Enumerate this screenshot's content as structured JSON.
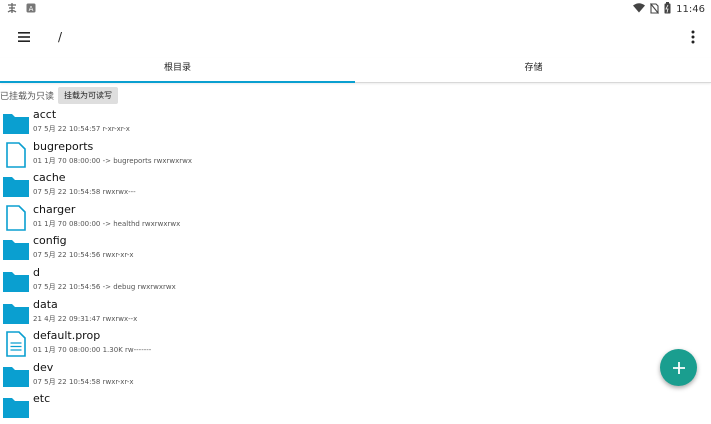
{
  "status_bar": {
    "time": "11:46"
  },
  "toolbar": {
    "path": "/"
  },
  "tabs": [
    {
      "label": "根目录"
    },
    {
      "label": "存储"
    }
  ],
  "mount": {
    "label": "已挂载为只读",
    "button_label": "挂载为可读写"
  },
  "files": [
    {
      "name": "acct",
      "icon": "folder-icon",
      "meta": "07 5月 22 10:54:57   r-xr-xr-x"
    },
    {
      "name": "bugreports",
      "icon": "file-icon",
      "meta": "01 1月 70 08:00:00  -> bugreports  rwxrwxrwx"
    },
    {
      "name": "cache",
      "icon": "folder-icon",
      "meta": "07 5月 22 10:54:58   rwxrwx---"
    },
    {
      "name": "charger",
      "icon": "file-icon",
      "meta": "01 1月 70 08:00:00  -> healthd  rwxrwxrwx"
    },
    {
      "name": "config",
      "icon": "folder-icon",
      "meta": "07 5月 22 10:54:56   rwxr-xr-x"
    },
    {
      "name": "d",
      "icon": "folder-icon",
      "meta": "07 5月 22 10:54:56  -> debug  rwxrwxrwx"
    },
    {
      "name": "data",
      "icon": "folder-icon",
      "meta": "21 4月 22 09:31:47   rwxrwx--x"
    },
    {
      "name": "default.prop",
      "icon": "document-icon",
      "meta": "01 1月 70 08:00:00  1.30K  rw-------"
    },
    {
      "name": "dev",
      "icon": "folder-icon",
      "meta": "07 5月 22 10:54:58   rwxr-xr-x"
    },
    {
      "name": "etc",
      "icon": "folder-icon",
      "meta": ""
    }
  ],
  "colors": {
    "folder": "#0a9fd0",
    "accent": "#0a9fd0",
    "fab": "#1a9e8f"
  }
}
